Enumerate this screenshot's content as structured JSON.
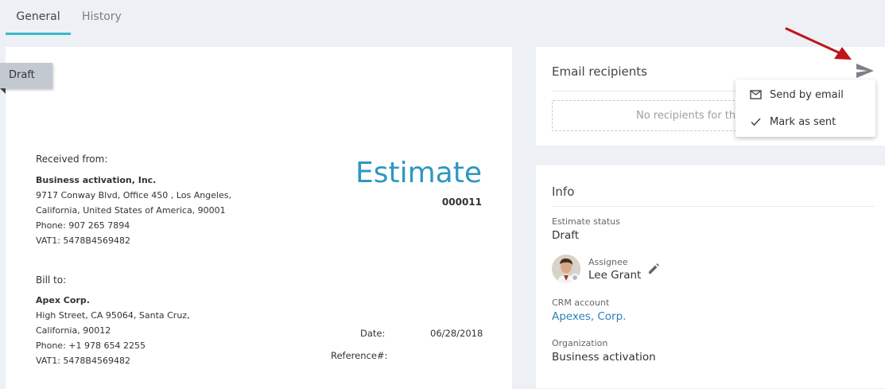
{
  "tabs": [
    {
      "label": "General",
      "active": true
    },
    {
      "label": "History",
      "active": false
    }
  ],
  "document": {
    "status_ribbon": "Draft",
    "title": "Estimate",
    "number": "000011",
    "received_from_label": "Received from:",
    "sender": {
      "name": "Business activation, Inc.",
      "line1": "9717 Conway Blvd, Office 450 , Los Angeles,",
      "line2": "California, United States of America, 90001",
      "phone": "Phone: 907 265 7894",
      "vat": "VAT1: 5478B4569482"
    },
    "bill_to_label": "Bill to:",
    "recipient": {
      "name": "Apex Corp.",
      "line1": "High Street, CA 95064, Santa Cruz,",
      "line2": "California, 90012",
      "phone": "Phone: +1 978 654 2255",
      "vat": "VAT1: 5478B4569482"
    },
    "date_label": "Date:",
    "date_value": "06/28/2018",
    "reference_label": "Reference#:"
  },
  "email": {
    "title": "Email recipients",
    "empty_text": "No recipients for this estimate"
  },
  "send_menu": {
    "items": [
      {
        "label": "Send by email",
        "icon": "mail-icon"
      },
      {
        "label": "Mark as sent",
        "icon": "check-icon"
      }
    ]
  },
  "info": {
    "title": "Info",
    "status_label": "Estimate status",
    "status_value": "Draft",
    "assignee_label": "Assignee",
    "assignee_value": "Lee Grant",
    "crm_label": "CRM account",
    "crm_value": "Apexes, Corp.",
    "org_label": "Organization",
    "org_value": "Business activation"
  },
  "colors": {
    "accent": "#3ab8c9",
    "title_blue": "#2e97c0",
    "link": "#2e7fb8",
    "annotation_arrow": "#c0141c"
  }
}
